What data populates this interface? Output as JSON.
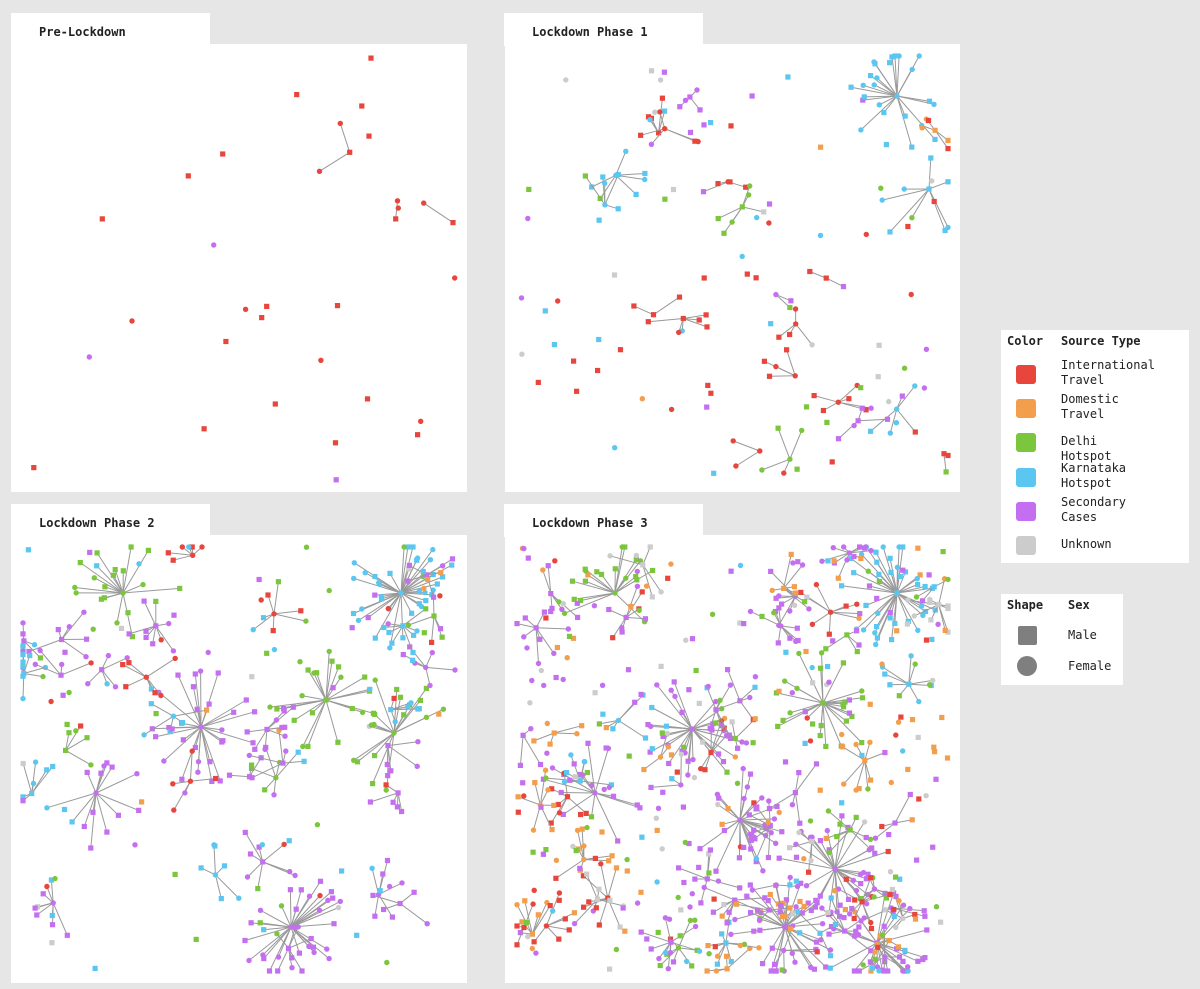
{
  "panels": [
    {
      "title": "Pre-Lockdown",
      "seed": 11,
      "density": "sparse"
    },
    {
      "title": "Lockdown Phase 1",
      "seed": 23,
      "density": "medium"
    },
    {
      "title": "Lockdown Phase 2",
      "seed": 37,
      "density": "dense"
    },
    {
      "title": "Lockdown Phase 3",
      "seed": 53,
      "density": "very-dense"
    }
  ],
  "legend": {
    "color_header": "Color",
    "source_header": "Source Type",
    "items": [
      {
        "label": "International\nTravel",
        "color": "#e8453c"
      },
      {
        "label": "Domestic\nTravel",
        "color": "#f29e4c"
      },
      {
        "label": "Delhi Hotspot",
        "color": "#7cc63e"
      },
      {
        "label": "Karnataka\nHotspot",
        "color": "#5bc6f0"
      },
      {
        "label": "Secondary\nCases",
        "color": "#c46ef0"
      },
      {
        "label": "Unknown",
        "color": "#cccccc"
      }
    ]
  },
  "shape_legend": {
    "shape_header": "Shape",
    "sex_header": "Sex",
    "items": [
      {
        "label": "Male",
        "shape": "square"
      },
      {
        "label": "Female",
        "shape": "circle"
      }
    ]
  },
  "edge_color": "#999999"
}
